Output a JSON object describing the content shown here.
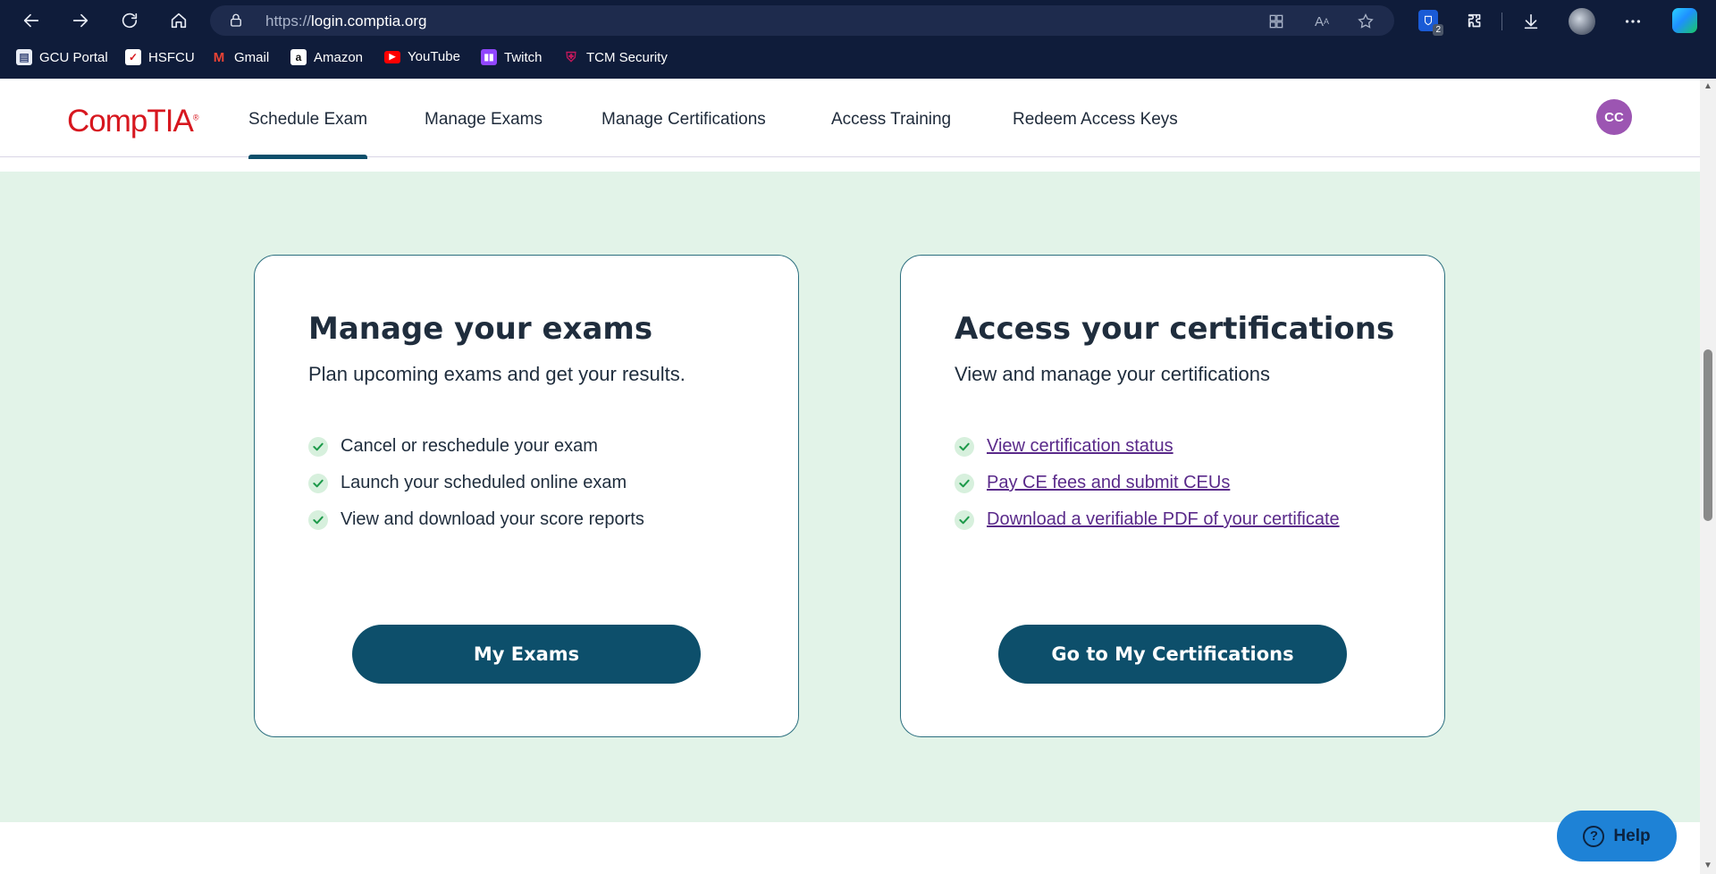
{
  "browser": {
    "url_protocol": "https://",
    "url_host": "login.comptia.org",
    "extension_badge": "2",
    "bookmarks": [
      {
        "label": "GCU Portal",
        "icon": "gcu-portal-icon"
      },
      {
        "label": "HSFCU",
        "icon": "hsfcu-icon"
      },
      {
        "label": "Gmail",
        "icon": "gmail-icon"
      },
      {
        "label": "Amazon",
        "icon": "amazon-icon"
      },
      {
        "label": "YouTube",
        "icon": "youtube-icon"
      },
      {
        "label": "Twitch",
        "icon": "twitch-icon"
      },
      {
        "label": "TCM Security",
        "icon": "tcm-security-icon"
      }
    ]
  },
  "header": {
    "logo": "CompTIA",
    "nav": [
      {
        "label": "Schedule Exam",
        "active": true
      },
      {
        "label": "Manage Exams",
        "active": false
      },
      {
        "label": "Manage Certifications",
        "active": false
      },
      {
        "label": "Access Training",
        "active": false
      },
      {
        "label": "Redeem Access Keys",
        "active": false
      }
    ],
    "user_initials": "CC"
  },
  "cards": {
    "exams": {
      "title": "Manage your exams",
      "subtitle": "Plan upcoming exams and get your results.",
      "items": [
        "Cancel or reschedule your exam",
        "Launch your scheduled online exam",
        "View and download your score reports"
      ],
      "button": "My Exams"
    },
    "certs": {
      "title": "Access your certifications",
      "subtitle": "View and manage your certifications",
      "links": [
        "View certification status",
        "Pay CE fees and submit CEUs",
        "Download a verifiable PDF of your certificate"
      ],
      "button": "Go to My Certifications"
    }
  },
  "help": {
    "label": "Help"
  },
  "colors": {
    "brand_red": "#d7171f",
    "primary_button": "#0d4f6b",
    "band_background": "#e2f3e8",
    "link": "#5a2a8a",
    "avatar": "#9c55b2",
    "help_button": "#1e82d6"
  }
}
